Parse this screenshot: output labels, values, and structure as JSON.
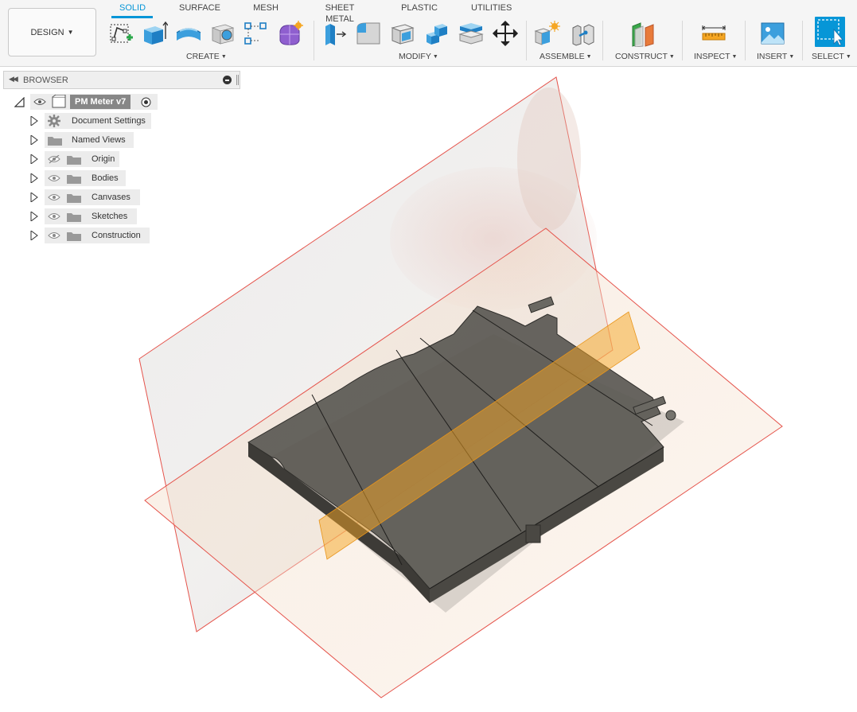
{
  "workspace": {
    "label": "DESIGN"
  },
  "tabs": [
    {
      "label": "SOLID",
      "active": true
    },
    {
      "label": "SURFACE",
      "active": false
    },
    {
      "label": "MESH",
      "active": false
    },
    {
      "label": "SHEET METAL",
      "active": false
    },
    {
      "label": "PLASTIC",
      "active": false
    },
    {
      "label": "UTILITIES",
      "active": false
    }
  ],
  "groups": {
    "create": "CREATE",
    "modify": "MODIFY",
    "assemble": "ASSEMBLE",
    "construct": "CONSTRUCT",
    "inspect": "INSPECT",
    "insert": "INSERT",
    "select": "SELECT"
  },
  "icons": {
    "create": [
      "create-sketch-icon",
      "extrude-icon",
      "revolve-icon",
      "hole-icon",
      "pattern-icon",
      "form-icon"
    ],
    "modify": [
      "press-pull-icon",
      "fillet-icon",
      "shell-icon",
      "combine-icon",
      "offset-face-icon",
      "move-icon"
    ],
    "assemble": [
      "new-component-icon",
      "joint-icon"
    ],
    "construct": "offset-plane-icon",
    "inspect": "measure-icon",
    "insert": "insert-image-icon",
    "select": "select-icon"
  },
  "browser": {
    "title": "BROWSER",
    "root": "PM Meter v7",
    "items": [
      {
        "label": "Document Settings",
        "icon": "gear-icon"
      },
      {
        "label": "Named Views",
        "icon": "folder-icon"
      },
      {
        "label": "Origin",
        "icon": "folder-icon",
        "hidden": true
      },
      {
        "label": "Bodies",
        "icon": "folder-icon"
      },
      {
        "label": "Canvases",
        "icon": "folder-icon"
      },
      {
        "label": "Sketches",
        "icon": "folder-icon"
      },
      {
        "label": "Construction",
        "icon": "folder-icon"
      }
    ]
  },
  "colors": {
    "accent": "#0696d7",
    "construction_plane": "#f5a623",
    "origin_plane_edge": "#e5534b",
    "body": "#5a5852"
  }
}
